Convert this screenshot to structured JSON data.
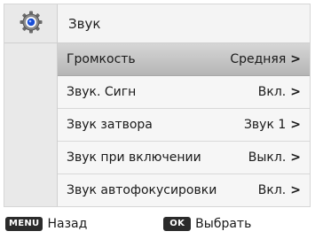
{
  "header": {
    "title": "Звук",
    "icon": "gear-icon"
  },
  "menu": {
    "items": [
      {
        "label": "Громкость",
        "value": "Средняя",
        "selected": true
      },
      {
        "label": "Звук. Сигн",
        "value": "Вкл.",
        "selected": false
      },
      {
        "label": "Звук затвора",
        "value": "Звук 1",
        "selected": false
      },
      {
        "label": "Звук при включении",
        "value": "Выкл.",
        "selected": false
      },
      {
        "label": "Звук автофокусировки",
        "value": "Вкл.",
        "selected": false
      }
    ]
  },
  "footer": {
    "back_key": "MENU",
    "back_label": "Назад",
    "select_key": "OK",
    "select_label": "Выбрать"
  },
  "colors": {
    "selected_row": "#c4c4c4",
    "key_bg": "#2b2b2b",
    "icon_blue": "#1a4fd6"
  }
}
